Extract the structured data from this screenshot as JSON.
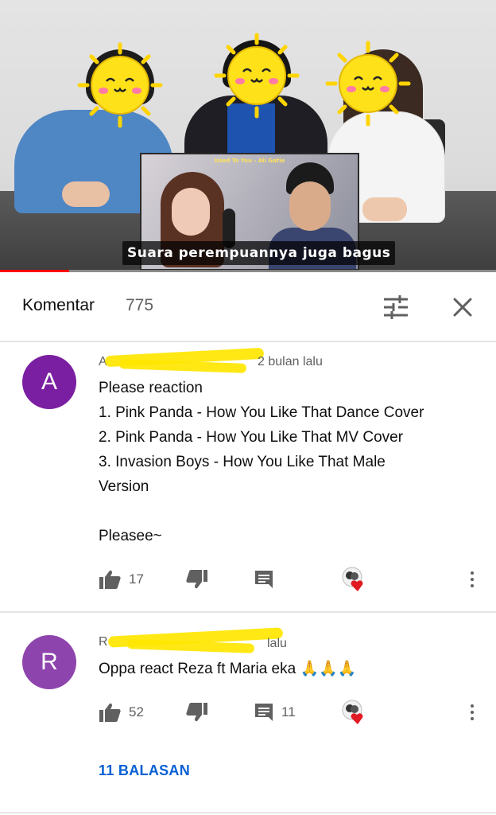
{
  "video": {
    "inset_title": "Used To You - Ali Gatie",
    "subtitle": "Suara perempuannya juga bagus",
    "progress_fraction": 0.14,
    "progress_color": "#ff0000"
  },
  "comments_header": {
    "title": "Komentar",
    "count": "775",
    "sort_icon": "sort-sliders-icon",
    "close_icon": "close-icon"
  },
  "comments": [
    {
      "avatar_letter": "A",
      "avatar_color": "#7b1fa2",
      "author_visible": "A",
      "timestamp": "2 bulan lalu",
      "lines": [
        "Please reaction",
        "1. Pink Panda - How You Like That Dance Cover",
        "2. Pink Panda - How You Like That MV Cover",
        "3. Invasion Boys - How You Like That Male",
        "Version",
        "",
        "Pleasee~"
      ],
      "likes": "17",
      "replies_count": ""
    },
    {
      "avatar_letter": "R",
      "avatar_color": "#8e44ad",
      "author_visible": "R",
      "timestamp": "lalu",
      "lines": [
        "Oppa react Reza ft Maria eka 🙏🙏🙏"
      ],
      "likes": "52",
      "replies_count": "11",
      "replies_link": "11 BALASAN"
    }
  ]
}
